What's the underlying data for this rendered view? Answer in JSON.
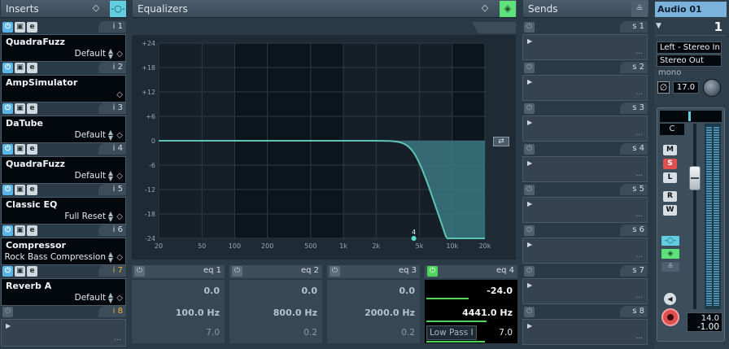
{
  "inserts": {
    "title": "Inserts",
    "slots": [
      {
        "index": "i 1",
        "name": "QuadraFuzz",
        "preset": "Default"
      },
      {
        "index": "i 2",
        "name": "AmpSimulator",
        "preset": ""
      },
      {
        "index": "i 3",
        "name": "DaTube",
        "preset": "Default"
      },
      {
        "index": "i 4",
        "name": "QuadraFuzz",
        "preset": "Default"
      },
      {
        "index": "i 5",
        "name": "Classic EQ",
        "preset": "Full Reset"
      },
      {
        "index": "i 6",
        "name": "Compressor",
        "preset": "Rock Bass Compression"
      },
      {
        "index": "i 7",
        "name": "Reverb A",
        "preset": "Default"
      },
      {
        "index": "i 8",
        "name": "",
        "preset": ""
      }
    ],
    "dots": "..."
  },
  "equalizers": {
    "title": "Equalizers",
    "db_ticks": [
      "+24",
      "+18",
      "+12",
      "+6",
      "0",
      "-6",
      "-12",
      "-18",
      "-24"
    ],
    "freq_ticks": [
      "20",
      "50",
      "100",
      "200",
      "500",
      "1k",
      "2k",
      "5k",
      "10k",
      "20k"
    ],
    "marker_label": "4",
    "bands": [
      {
        "label": "eq 1",
        "gain": "0.0",
        "freq": "100.0 Hz",
        "q": "7.0",
        "active": false,
        "type": ""
      },
      {
        "label": "eq 2",
        "gain": "0.0",
        "freq": "800.0 Hz",
        "q": "0.2",
        "active": false,
        "type": ""
      },
      {
        "label": "eq 3",
        "gain": "0.0",
        "freq": "2000.0 Hz",
        "q": "0.2",
        "active": false,
        "type": ""
      },
      {
        "label": "eq 4",
        "gain": "-24.0",
        "freq": "4441.0 Hz",
        "q": "7.0",
        "active": true,
        "type": "Low Pass I"
      }
    ]
  },
  "sends": {
    "title": "Sends",
    "slots": [
      "s 1",
      "s 2",
      "s 3",
      "s 4",
      "s 5",
      "s 6",
      "s 7",
      "s 8"
    ],
    "dots": "..."
  },
  "channel": {
    "name": "Audio 01",
    "number": "1",
    "input": "Left - Stereo In",
    "output": "Stereo Out",
    "mode": "mono",
    "pan_value": "17.0",
    "pan_label": "C",
    "buttons": {
      "mute": "M",
      "solo": "S",
      "listen": "L",
      "read": "R",
      "write": "W"
    },
    "meter_peak": "14.0",
    "fader_value": "-1.00"
  },
  "colors": {
    "accent_cyan": "#62cfe0",
    "accent_green": "#4fd45c",
    "eq_fill": "#3b7882",
    "eq_curve": "#5fc3b4",
    "insert_orange": "#f0b040",
    "solo_red": "#e05050"
  }
}
